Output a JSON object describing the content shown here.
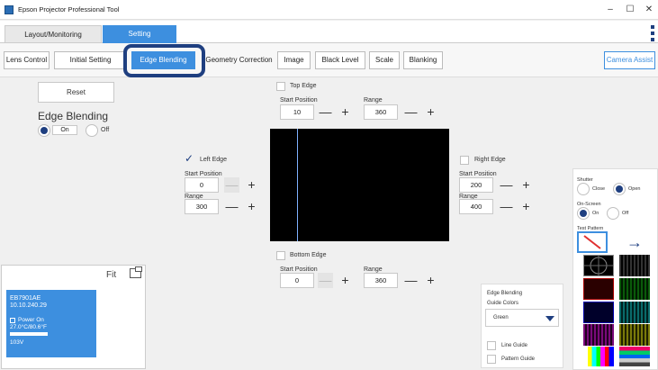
{
  "window": {
    "title": "Epson Projector Professional Tool",
    "minimize": "–",
    "maximize": "☐",
    "close": "✕"
  },
  "main_tabs": [
    {
      "label": "Layout/Monitoring",
      "active": false
    },
    {
      "label": "Setting",
      "active": true
    }
  ],
  "sub_tabs": [
    "Lens Control",
    "Initial Setting",
    "Edge Blending",
    "Geometry Correction",
    "Image",
    "Black Level",
    "Scale",
    "Blanking"
  ],
  "camera_assist": "Camera Assist",
  "reset": "Reset",
  "edge_blending": {
    "title": "Edge Blending",
    "on": "On",
    "off": "Off"
  },
  "top_edge": {
    "label": "Top Edge",
    "start_label": "Start Position",
    "start": "10",
    "range_label": "Range",
    "range": "360"
  },
  "left_edge": {
    "label": "Left Edge",
    "start_label": "Start Position",
    "start": "0",
    "range_label": "Range",
    "range": "300"
  },
  "right_edge": {
    "label": "Right Edge",
    "start_label": "Start Position",
    "start": "200",
    "range_label": "Range",
    "range": "400"
  },
  "bottom_edge": {
    "label": "Bottom Edge",
    "start_label": "Start Position",
    "start": "0",
    "range_label": "Range",
    "range": "360"
  },
  "projector": {
    "fit": "Fit",
    "name": "EB7901AE",
    "ip": "10.10.240.29",
    "status": "Power On",
    "temp": "27.0°C/80.6°F",
    "voltage": "103V"
  },
  "guide": {
    "title": "Edge Blending",
    "colors_label": "Guide Colors",
    "color": "Green",
    "line_guide": "Line Guide",
    "pattern_guide": "Pattern Guide"
  },
  "right_panel": {
    "shutter": "Shutter",
    "close": "Close",
    "open": "Open",
    "on_screen": "On-Screen",
    "on": "On",
    "off": "Off",
    "test_pattern": "Test Pattern"
  },
  "colors": {
    "accent": "#3d8fdf",
    "highlight": "#1f3f80",
    "projector_card": "#3d8fdf"
  }
}
